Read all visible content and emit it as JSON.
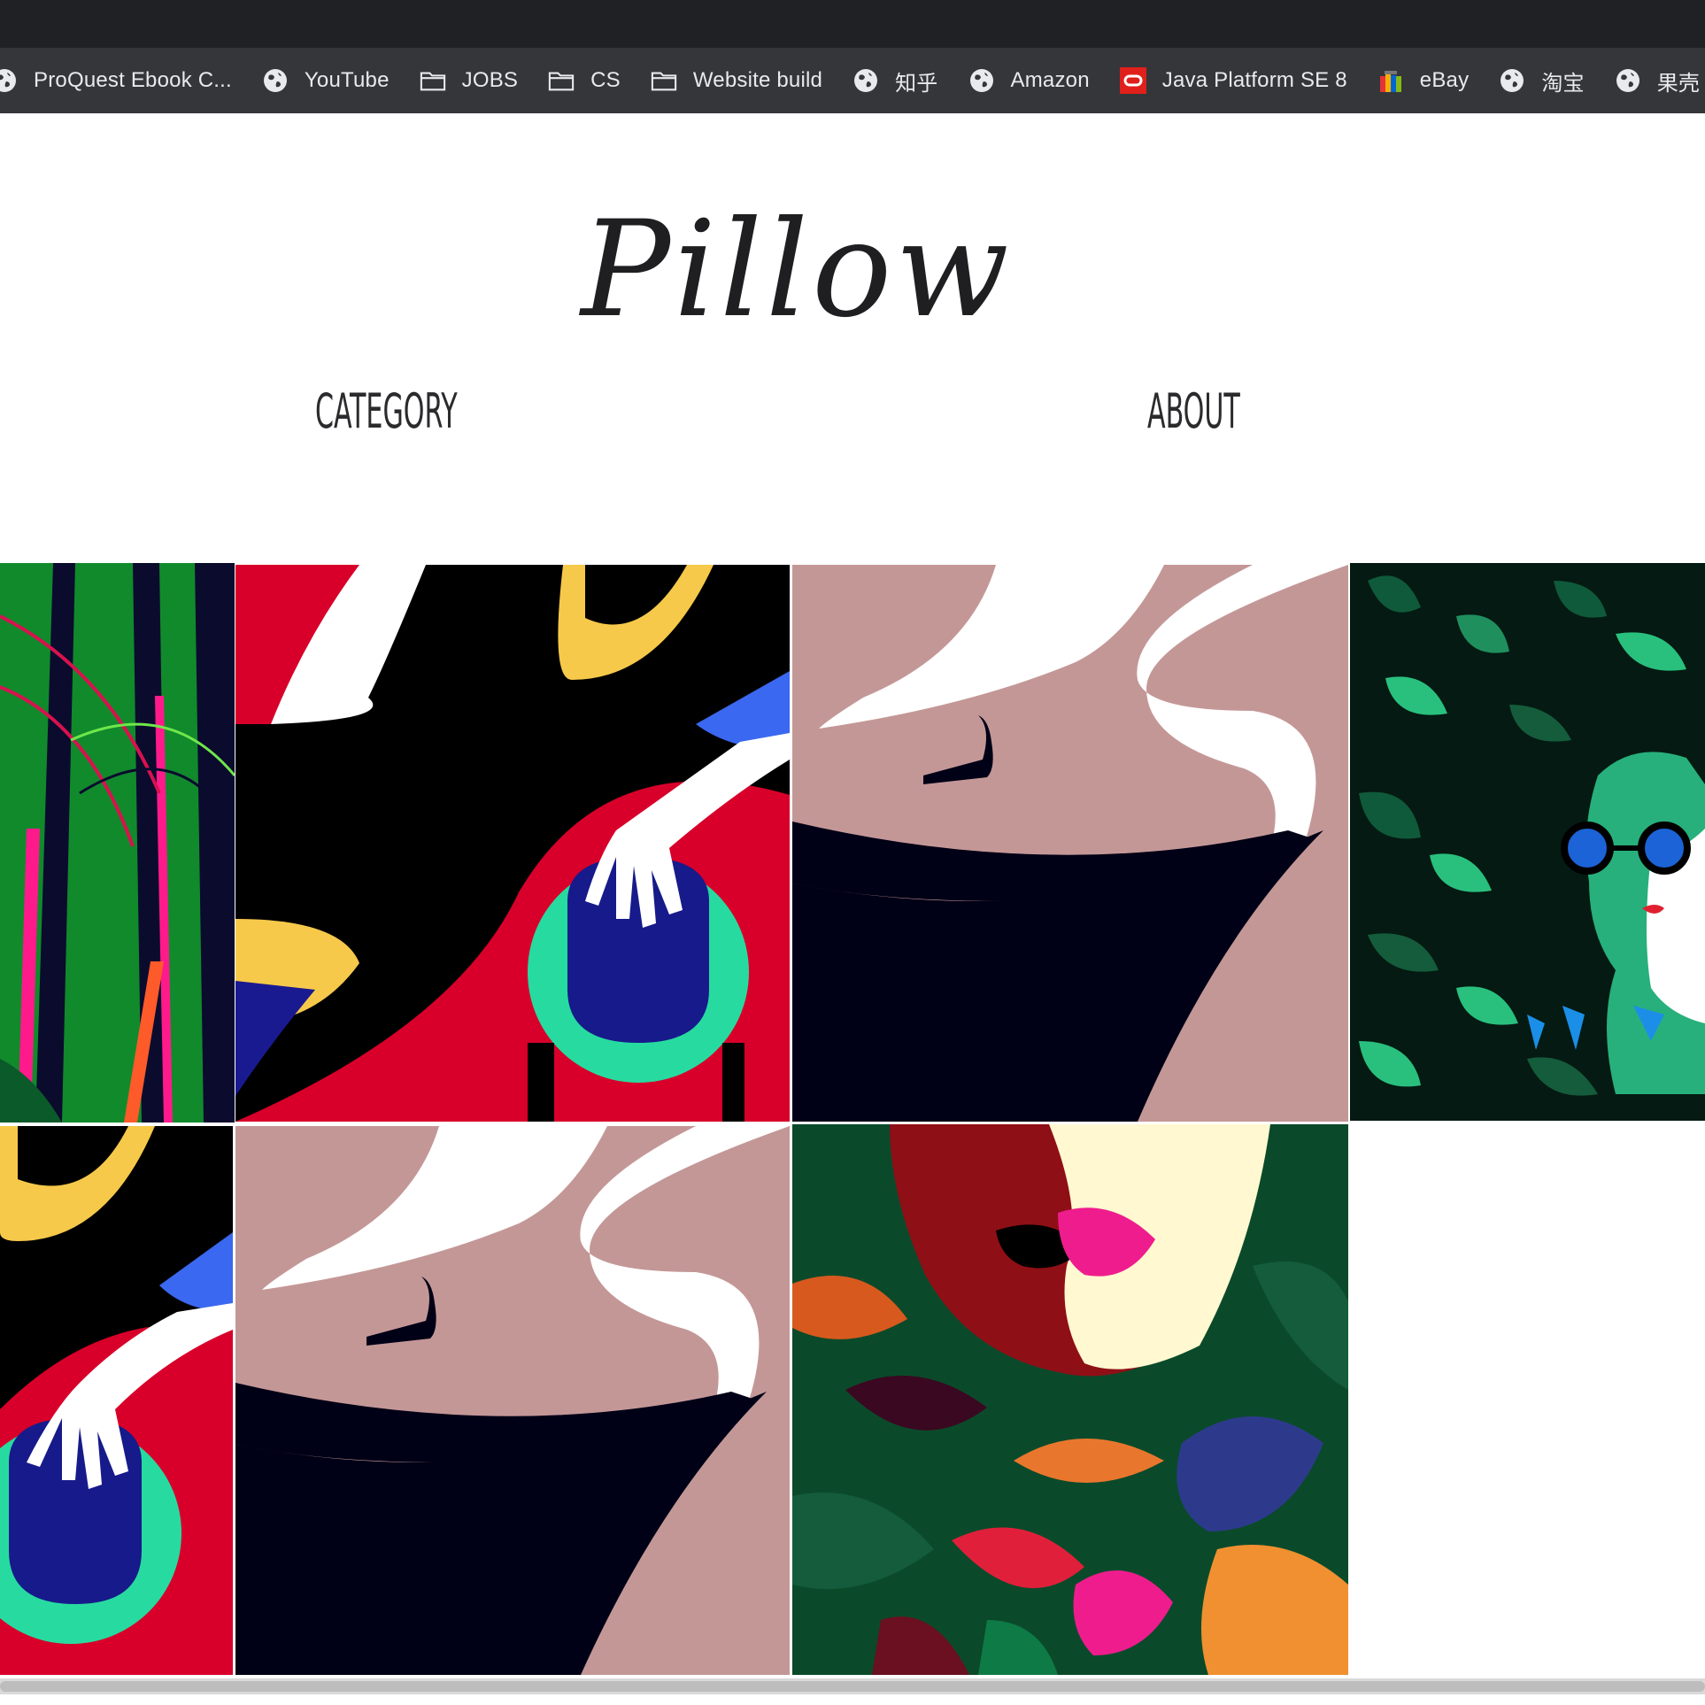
{
  "bookmarks": [
    {
      "label": "ProQuest Ebook C...",
      "icon": "globe-icon"
    },
    {
      "label": "YouTube",
      "icon": "globe-icon"
    },
    {
      "label": "JOBS",
      "icon": "folder-icon"
    },
    {
      "label": "CS",
      "icon": "folder-icon"
    },
    {
      "label": "Website build",
      "icon": "folder-icon"
    },
    {
      "label": "知乎",
      "icon": "globe-icon"
    },
    {
      "label": "Amazon",
      "icon": "globe-icon"
    },
    {
      "label": "Java Platform SE 8",
      "icon": "oracle-icon"
    },
    {
      "label": "eBay",
      "icon": "ebay-icon"
    },
    {
      "label": "淘宝",
      "icon": "globe-icon"
    },
    {
      "label": "果壳",
      "icon": "globe-icon"
    }
  ],
  "site": {
    "logo": "Pillow",
    "nav": {
      "category": "CATEGORY",
      "about": "ABOUT"
    }
  },
  "gallery": [
    {
      "name": "jungle-palms"
    },
    {
      "name": "hand-on-ball-red"
    },
    {
      "name": "steaming-cup"
    },
    {
      "name": "woman-in-leaves"
    },
    {
      "name": "hand-on-ball-red-crop"
    },
    {
      "name": "steaming-cup-2"
    },
    {
      "name": "woman-lips-foliage"
    }
  ],
  "colors": {
    "chrome_dark": "#202124",
    "bookmarks_bar": "#35363a",
    "bookmark_text": "#e8eaed",
    "page_bg": "#ffffff",
    "logo": "#1f1f22"
  }
}
